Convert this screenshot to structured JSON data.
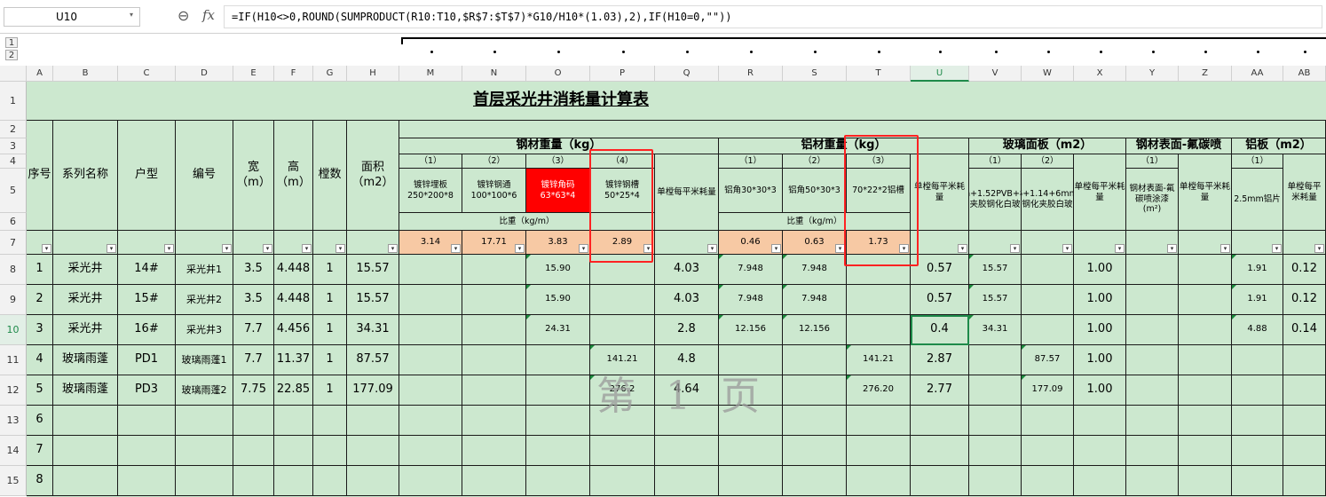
{
  "formula_bar": {
    "name_box": "U10",
    "formula": "=IF(H10<>0,ROUND(SUMPRODUCT(R10:T10,$R$7:$T$7)*G10/H10*(1.03),2),IF(H10=0,\"\"))"
  },
  "outline_levels": [
    "1",
    "2"
  ],
  "columns": [
    "A",
    "B",
    "C",
    "D",
    "E",
    "F",
    "G",
    "H",
    "M",
    "N",
    "O",
    "P",
    "Q",
    "R",
    "S",
    "T",
    "U",
    "V",
    "W",
    "X",
    "Y",
    "Z",
    "AA",
    "AB"
  ],
  "rows": [
    "1",
    "2",
    "3",
    "4",
    "5",
    "6",
    "7",
    "8",
    "9",
    "10",
    "11",
    "12",
    "13",
    "14",
    "15"
  ],
  "sheet": {
    "title": "首层采光井消耗量计算表",
    "headers": {
      "seq": "序号",
      "series": "系列名称",
      "type": "户型",
      "code": "编号",
      "width": "宽（m）",
      "height": "高（m）",
      "count": "樘数",
      "area": "面积（m2）",
      "steel_group": "钢材重量（kg）",
      "al_group": "铝材重量（kg）",
      "glass_group": "玻璃面板（m2）",
      "fluoro_group": "钢材表面-氟碳喷",
      "alplate_group": "铝板（m2）",
      "steel_idx": [
        "（1）",
        "（2）",
        "（3）",
        "（4）"
      ],
      "steel_names": [
        "镀锌埋板250*200*8",
        "镀锌钢通100*100*6",
        "镀锌角码63*63*4",
        "镀锌钢槽50*25*4"
      ],
      "steel_density_label": "比重（kg/m）",
      "steel_density": [
        "3.14",
        "17.71",
        "3.83",
        "2.89"
      ],
      "steel_per_m2": "单樘每平米耗量",
      "al_idx": [
        "（1）",
        "（2）",
        "（3）"
      ],
      "al_names": [
        "铝角30*30*3",
        "铝角50*30*3",
        "70*22*2铝槽"
      ],
      "al_density_label": "比重（kg/m）",
      "al_density": [
        "0.46",
        "0.63",
        "1.73"
      ],
      "al_per_m2": "单樘每平米耗量",
      "glass_idx": [
        "（1）",
        "（2）"
      ],
      "glass_names": [
        "8mm+1.52PVB+8mm夹胶钢化白玻",
        "6+1.14+6mm钢化夹胶白玻"
      ],
      "glass_per_m2": "单樘每平米耗量",
      "fluoro_idx": "（1）",
      "fluoro_name": "钢材表面-氟碳喷涂漆(m²)",
      "fluoro_per_m2": "单樘每平米耗量",
      "alplate_idx": "（1）",
      "alplate_name": "2.5mm铝片",
      "alplate_per_m2": "单樘每平米耗量"
    },
    "data_rows": [
      {
        "seq": "1",
        "series": "采光井",
        "type": "14#",
        "code": "采光井1",
        "w": "3.5",
        "h": "4.448",
        "n": "1",
        "area": "15.57",
        "M": "",
        "N": "",
        "O": "15.90",
        "P": "",
        "Q": "4.03",
        "R": "7.948",
        "S": "7.948",
        "T": "",
        "U": "0.57",
        "V": "15.57",
        "W": "",
        "X": "1.00",
        "Y": "",
        "Z": "",
        "AA": "1.91",
        "AB": "0.12"
      },
      {
        "seq": "2",
        "series": "采光井",
        "type": "15#",
        "code": "采光井2",
        "w": "3.5",
        "h": "4.448",
        "n": "1",
        "area": "15.57",
        "M": "",
        "N": "",
        "O": "15.90",
        "P": "",
        "Q": "4.03",
        "R": "7.948",
        "S": "7.948",
        "T": "",
        "U": "0.57",
        "V": "15.57",
        "W": "",
        "X": "1.00",
        "Y": "",
        "Z": "",
        "AA": "1.91",
        "AB": "0.12"
      },
      {
        "seq": "3",
        "series": "采光井",
        "type": "16#",
        "code": "采光井3",
        "w": "7.7",
        "h": "4.456",
        "n": "1",
        "area": "34.31",
        "M": "",
        "N": "",
        "O": "24.31",
        "P": "",
        "Q": "2.8",
        "R": "12.156",
        "S": "12.156",
        "T": "",
        "U": "0.4",
        "V": "34.31",
        "W": "",
        "X": "1.00",
        "Y": "",
        "Z": "",
        "AA": "4.88",
        "AB": "0.14"
      },
      {
        "seq": "4",
        "series": "玻璃雨蓬",
        "type": "PD1",
        "code": "玻璃雨蓬1",
        "w": "7.7",
        "h": "11.37",
        "n": "1",
        "area": "87.57",
        "M": "",
        "N": "",
        "O": "",
        "P": "141.21",
        "Q": "4.8",
        "R": "",
        "S": "",
        "T": "141.21",
        "U": "2.87",
        "V": "",
        "W": "87.57",
        "X": "1.00",
        "Y": "",
        "Z": "",
        "AA": "",
        "AB": ""
      },
      {
        "seq": "5",
        "series": "玻璃雨蓬",
        "type": "PD3",
        "code": "玻璃雨蓬2",
        "w": "7.75",
        "h": "22.85",
        "n": "1",
        "area": "177.09",
        "M": "",
        "N": "",
        "O": "",
        "P": "276.2",
        "Q": "4.64",
        "R": "",
        "S": "",
        "T": "276.20",
        "U": "2.77",
        "V": "",
        "W": "177.09",
        "X": "1.00",
        "Y": "",
        "Z": "",
        "AA": "",
        "AB": ""
      },
      {
        "seq": "6"
      },
      {
        "seq": "7"
      },
      {
        "seq": "8"
      }
    ]
  },
  "watermark": "第 1 页",
  "colors": {
    "green": "#cce8cf",
    "orange": "#f7c9a4",
    "red": "#ff0000",
    "box": "#ff2222",
    "selection": "#1e8a4a"
  }
}
